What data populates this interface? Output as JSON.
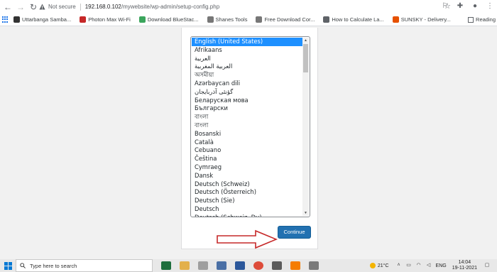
{
  "browser": {
    "security_label": "Not secure",
    "url_host": "192.168.0.102",
    "url_path": "/mywebsite/wp-admin/setup-config.php",
    "bookmarks": [
      {
        "label": "Uttarbanga Samba...",
        "color": "#333333"
      },
      {
        "label": "Photon Max Wi-Fi",
        "color": "#c62828"
      },
      {
        "label": "Download BlueStac...",
        "color": "#3ba55c"
      },
      {
        "label": "Shanes Tools",
        "color": "#777777"
      },
      {
        "label": "Free Download Cor...",
        "color": "#777777"
      },
      {
        "label": "How to Calculate La...",
        "color": "#5f6368"
      },
      {
        "label": "SUNSKY - Delivery...",
        "color": "#e65100"
      }
    ],
    "reading_list_label": "Reading"
  },
  "setup": {
    "languages": [
      "English (United States)",
      "Afrikaans",
      "العربية",
      "العربية المغربية",
      "অসমীয়া",
      "Azərbaycan dili",
      "گؤنئی آذربایجان",
      "Беларуская мова",
      "Български",
      "বাংলা",
      "বাংলা",
      "Bosanski",
      "Català",
      "Cebuano",
      "Čeština",
      "Cymraeg",
      "Dansk",
      "Deutsch (Schweiz)",
      "Deutsch (Österreich)",
      "Deutsch (Sie)",
      "Deutsch",
      "Deutsch (Schweiz, Du)"
    ],
    "selected_language": "English (United States)",
    "continue_label": "Continue",
    "accent_color": "#2271b1",
    "arrow_color": "#c62828"
  },
  "taskbar": {
    "search_placeholder": "Type here to search",
    "weather": "21°C",
    "language": "ENG",
    "time": "14:04",
    "date": "19-11-2021"
  }
}
